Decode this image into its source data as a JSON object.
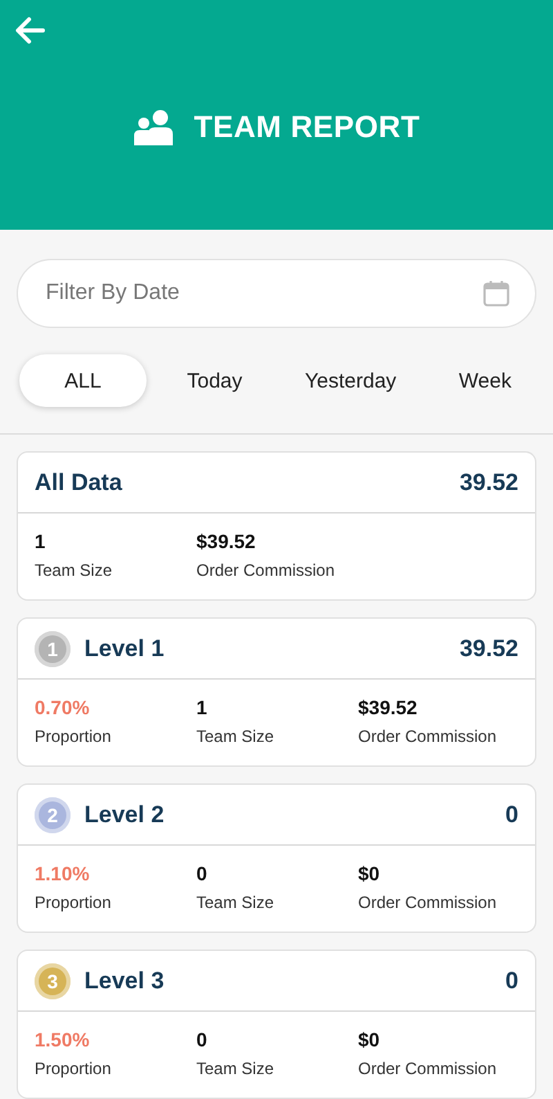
{
  "header": {
    "title": "TEAM REPORT"
  },
  "filter": {
    "placeholder": "Filter By Date"
  },
  "tabs": [
    {
      "label": "ALL",
      "selected": true
    },
    {
      "label": "Today",
      "selected": false
    },
    {
      "label": "Yesterday",
      "selected": false
    },
    {
      "label": "Week",
      "selected": false
    }
  ],
  "summary": {
    "title": "All Data",
    "total": "39.52",
    "stats": [
      {
        "value": "1",
        "label": "Team Size"
      },
      {
        "value": "$39.52",
        "label": "Order Commission"
      }
    ]
  },
  "levels": [
    {
      "title": "Level 1",
      "medal": "1",
      "color": "#b4b4b4",
      "total": "39.52",
      "proportion": "0.70%",
      "proportion_label": "Proportion",
      "stats": [
        {
          "value": "1",
          "label": "Team Size"
        },
        {
          "value": "$39.52",
          "label": "Order Commission"
        }
      ]
    },
    {
      "title": "Level 2",
      "medal": "2",
      "color": "#aab6de",
      "total": "0",
      "proportion": "1.10%",
      "proportion_label": "Proportion",
      "stats": [
        {
          "value": "0",
          "label": "Team Size"
        },
        {
          "value": "$0",
          "label": "Order Commission"
        }
      ]
    },
    {
      "title": "Level 3",
      "medal": "3",
      "color": "#d6b457",
      "total": "0",
      "proportion": "1.50%",
      "proportion_label": "Proportion",
      "stats": [
        {
          "value": "0",
          "label": "Team Size"
        },
        {
          "value": "$0",
          "label": "Order Commission"
        }
      ]
    }
  ]
}
